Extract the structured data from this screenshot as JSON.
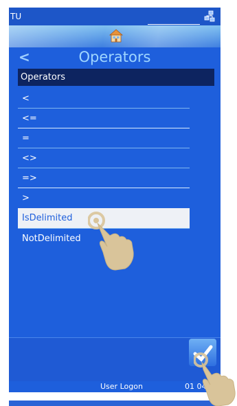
{
  "status_bar": {
    "app_label": "TU"
  },
  "header": {
    "title": "Operators",
    "back_glyph": "<"
  },
  "section": {
    "header": "Operators"
  },
  "operators": [
    {
      "label": "<"
    },
    {
      "label": "<="
    },
    {
      "label": "="
    },
    {
      "label": "<>"
    },
    {
      "label": "=>"
    },
    {
      "label": ">"
    },
    {
      "label": "IsDelimited",
      "selected": true
    },
    {
      "label": "NotDelimited"
    }
  ],
  "footer": {
    "user_label": "User Logon",
    "time": "01 04"
  },
  "colors": {
    "accent": "#1e5fdc",
    "section": "#0d2460",
    "title": "#9fd6ff",
    "selected_bg": "#eef1f6"
  },
  "icons": [
    "home-icon",
    "network-icon",
    "back-chevron-icon",
    "next-icon",
    "pointer-hand-icon"
  ]
}
